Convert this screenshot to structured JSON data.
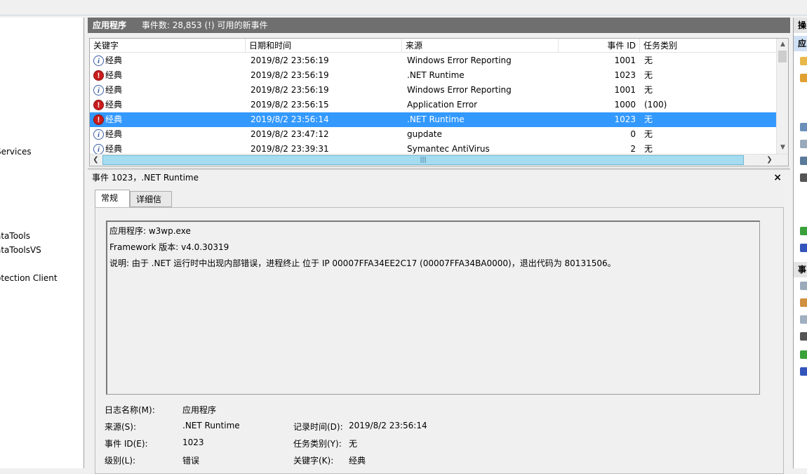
{
  "tree": {
    "items": [
      "Services",
      "ataTools",
      "ataToolsVS",
      "otection Client"
    ]
  },
  "header": {
    "log_name": "应用程序",
    "event_count": "事件数: 28,853 (!) 可用的新事件"
  },
  "grid": {
    "columns": [
      "关键字",
      "日期和时间",
      "来源",
      "事件 ID",
      "任务类别"
    ],
    "rows": [
      {
        "level": "info",
        "keyword": "经典",
        "date": "2019/8/2 23:56:19",
        "source": "Windows Error Reporting",
        "id": "1001",
        "task": "无"
      },
      {
        "level": "error",
        "keyword": "经典",
        "date": "2019/8/2 23:56:19",
        "source": ".NET Runtime",
        "id": "1023",
        "task": "无"
      },
      {
        "level": "info",
        "keyword": "经典",
        "date": "2019/8/2 23:56:19",
        "source": "Windows Error Reporting",
        "id": "1001",
        "task": "无"
      },
      {
        "level": "error",
        "keyword": "经典",
        "date": "2019/8/2 23:56:15",
        "source": "Application Error",
        "id": "1000",
        "task": "(100)"
      },
      {
        "level": "error",
        "keyword": "经典",
        "date": "2019/8/2 23:56:14",
        "source": ".NET Runtime",
        "id": "1023",
        "task": "无",
        "selected": true
      },
      {
        "level": "info",
        "keyword": "经典",
        "date": "2019/8/2 23:47:12",
        "source": "gupdate",
        "id": "0",
        "task": "无"
      },
      {
        "level": "info",
        "keyword": "经典",
        "date": "2019/8/2 23:39:31",
        "source": "Symantec AntiVirus",
        "id": "2",
        "task": "无"
      }
    ]
  },
  "detail": {
    "title": "事件 1023，.NET Runtime",
    "close_icon": "×",
    "tabs": [
      "常规",
      "详细信息"
    ],
    "description": [
      "应用程序: w3wp.exe",
      "Framework 版本: v4.0.30319",
      "说明: 由于 .NET 运行时中出现内部错误，进程终止 位于 IP 00007FFA34EE2C17 (00007FFA34BA0000)，退出代码为 80131506。"
    ],
    "fields": {
      "log_name_label": "日志名称(M):",
      "log_name_value": "应用程序",
      "source_label": "来源(S):",
      "source_value": ".NET Runtime",
      "logged_label": "记录时间(D):",
      "logged_value": "2019/8/2 23:56:14",
      "event_id_label": "事件 ID(E):",
      "event_id_value": "1023",
      "task_label": "任务类别(Y):",
      "task_value": "无",
      "level_label": "级别(L):",
      "level_value": "错误",
      "keyword_label": "关键字(K):",
      "keyword_value": "经典"
    }
  },
  "actions": {
    "header1": "操",
    "header2": "应",
    "header3": "事"
  },
  "colors": {
    "selection": "#3399ff",
    "header_bg": "#6f6f6f"
  }
}
